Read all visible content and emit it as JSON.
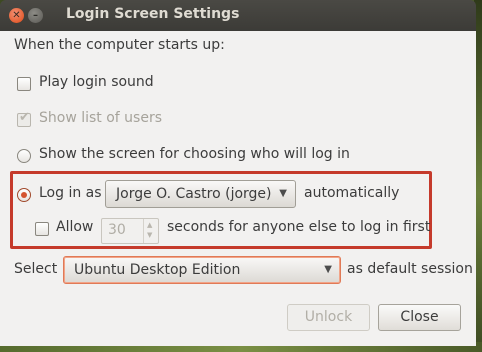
{
  "window": {
    "title": "Login Screen Settings"
  },
  "heading": "When the computer starts up:",
  "options": {
    "play_sound": {
      "label": "Play login sound",
      "checked": false
    },
    "show_users": {
      "label": "Show list of users",
      "checked": true,
      "enabled": false
    },
    "show_screen": {
      "label": "Show the screen for choosing who will log in",
      "selected": false
    },
    "login_as": {
      "label": "Log in as",
      "selected": true,
      "user": "Jorge O. Castro (jorge)",
      "suffix": "automatically"
    },
    "allow": {
      "label": "Allow",
      "checked": false,
      "seconds_value": "30",
      "suffix": "seconds for anyone else to log in first"
    }
  },
  "session": {
    "label": "Select",
    "value": "Ubuntu Desktop Edition",
    "suffix": "as default session"
  },
  "buttons": {
    "unlock": "Unlock",
    "close": "Close"
  },
  "colors": {
    "accent": "#df4a16",
    "highlight_border": "#c53a2b"
  }
}
